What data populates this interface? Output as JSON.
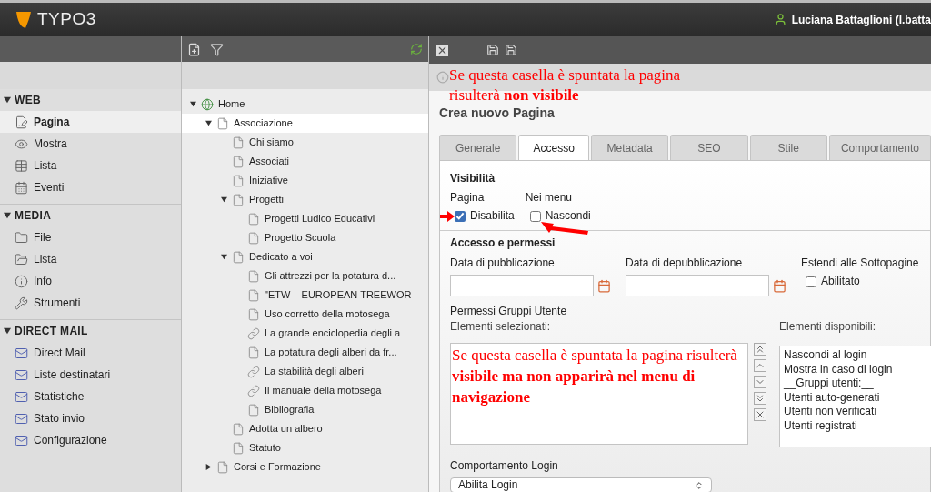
{
  "header": {
    "logo": "TYPO3",
    "user": "Luciana Battaglioni (l.batta"
  },
  "modules": [
    {
      "title": "WEB",
      "expanded": true,
      "items": [
        {
          "label": "Pagina",
          "selected": true
        },
        {
          "label": "Mostra",
          "selected": false
        },
        {
          "label": "Lista",
          "selected": false
        },
        {
          "label": "Eventi",
          "selected": false
        }
      ]
    },
    {
      "title": "MEDIA",
      "expanded": true,
      "items": [
        {
          "label": "File",
          "selected": false
        },
        {
          "label": "Lista",
          "selected": false
        },
        {
          "label": "Info",
          "selected": false
        },
        {
          "label": "Strumenti",
          "selected": false
        }
      ]
    },
    {
      "title": "DIRECT MAIL",
      "expanded": true,
      "items": [
        {
          "label": "Direct Mail",
          "selected": false
        },
        {
          "label": "Liste destinatari",
          "selected": false
        },
        {
          "label": "Statistiche",
          "selected": false
        },
        {
          "label": "Stato invio",
          "selected": false
        },
        {
          "label": "Configurazione",
          "selected": false
        }
      ]
    }
  ],
  "tree": [
    {
      "label": "Home",
      "kind": "site",
      "expanded": true,
      "selected": false,
      "children": [
        {
          "label": "Associazione",
          "kind": "page",
          "expanded": true,
          "selected": true,
          "children": [
            {
              "label": "Chi siamo",
              "kind": "page",
              "selected": false
            },
            {
              "label": "Associati",
              "kind": "page",
              "selected": false
            },
            {
              "label": "Iniziative",
              "kind": "page",
              "selected": false
            },
            {
              "label": "Progetti",
              "kind": "page",
              "expanded": true,
              "selected": false,
              "children": [
                {
                  "label": "Progetti Ludico Educativi",
                  "kind": "page",
                  "selected": false
                },
                {
                  "label": "Progetto Scuola",
                  "kind": "page",
                  "selected": false
                }
              ]
            },
            {
              "label": "Dedicato a voi",
              "kind": "page",
              "expanded": true,
              "selected": false,
              "children": [
                {
                  "label": "Gli attrezzi per la potatura d...",
                  "kind": "page",
                  "selected": false
                },
                {
                  "label": "\"ETW – EUROPEAN TREEWOR",
                  "kind": "page",
                  "selected": false
                },
                {
                  "label": "Uso corretto della motosega",
                  "kind": "page",
                  "selected": false
                },
                {
                  "label": "La grande enciclopedia degli a",
                  "kind": "link",
                  "selected": false
                },
                {
                  "label": "La potatura degli alberi da fr...",
                  "kind": "page",
                  "selected": false
                },
                {
                  "label": "La stabilità degli alberi",
                  "kind": "link",
                  "selected": false
                },
                {
                  "label": "Il manuale della motosega",
                  "kind": "link",
                  "selected": false
                },
                {
                  "label": "Bibliografia",
                  "kind": "page",
                  "selected": false
                }
              ]
            },
            {
              "label": "Adotta un albero",
              "kind": "page",
              "selected": false
            },
            {
              "label": "Statuto",
              "kind": "page",
              "selected": false
            }
          ]
        },
        {
          "label": "Corsi e Formazione",
          "kind": "page",
          "expanded": false,
          "selected": false
        }
      ]
    }
  ],
  "form": {
    "title": "Crea nuovo Pagina",
    "tabs": [
      {
        "label": "Generale",
        "selected": false
      },
      {
        "label": "Accesso",
        "selected": true
      },
      {
        "label": "Metadata",
        "selected": false
      },
      {
        "label": "SEO",
        "selected": false
      },
      {
        "label": "Stile",
        "selected": false
      },
      {
        "label": "Comportamento",
        "selected": false
      }
    ],
    "visibility": {
      "heading": "Visibilità",
      "columns": [
        {
          "label": "Pagina",
          "option": "Disabilita",
          "checked": true
        },
        {
          "label": "Nei menu",
          "option": "Nascondi",
          "checked": false
        }
      ]
    },
    "access": {
      "heading": "Accesso e permessi",
      "start_label": "Data di pubblicazione",
      "end_label": "Data di depubblicazione",
      "extend_label": "Estendi alle Sottopagine",
      "extend_option": "Abilitato",
      "extend_checked": false
    },
    "groups": {
      "heading": "Permessi Gruppi Utente",
      "selected_label": "Elementi selezionati:",
      "available_label": "Elementi disponibili:",
      "available": [
        "Nascondi al login",
        "Mostra in caso di login",
        "__Gruppi utenti:__",
        "Utenti auto-generati",
        "Utenti non verificati",
        "Utenti registrati"
      ]
    },
    "login": {
      "label": "Comportamento Login",
      "value": "Abilita Login"
    }
  },
  "annotations": [
    "Se questa casella è spuntata la pagina risulterà **non visibile**",
    "Se questa casella è spuntata la pagina risulterà **visibile ma non apparirà nel menu di navigazione**"
  ]
}
